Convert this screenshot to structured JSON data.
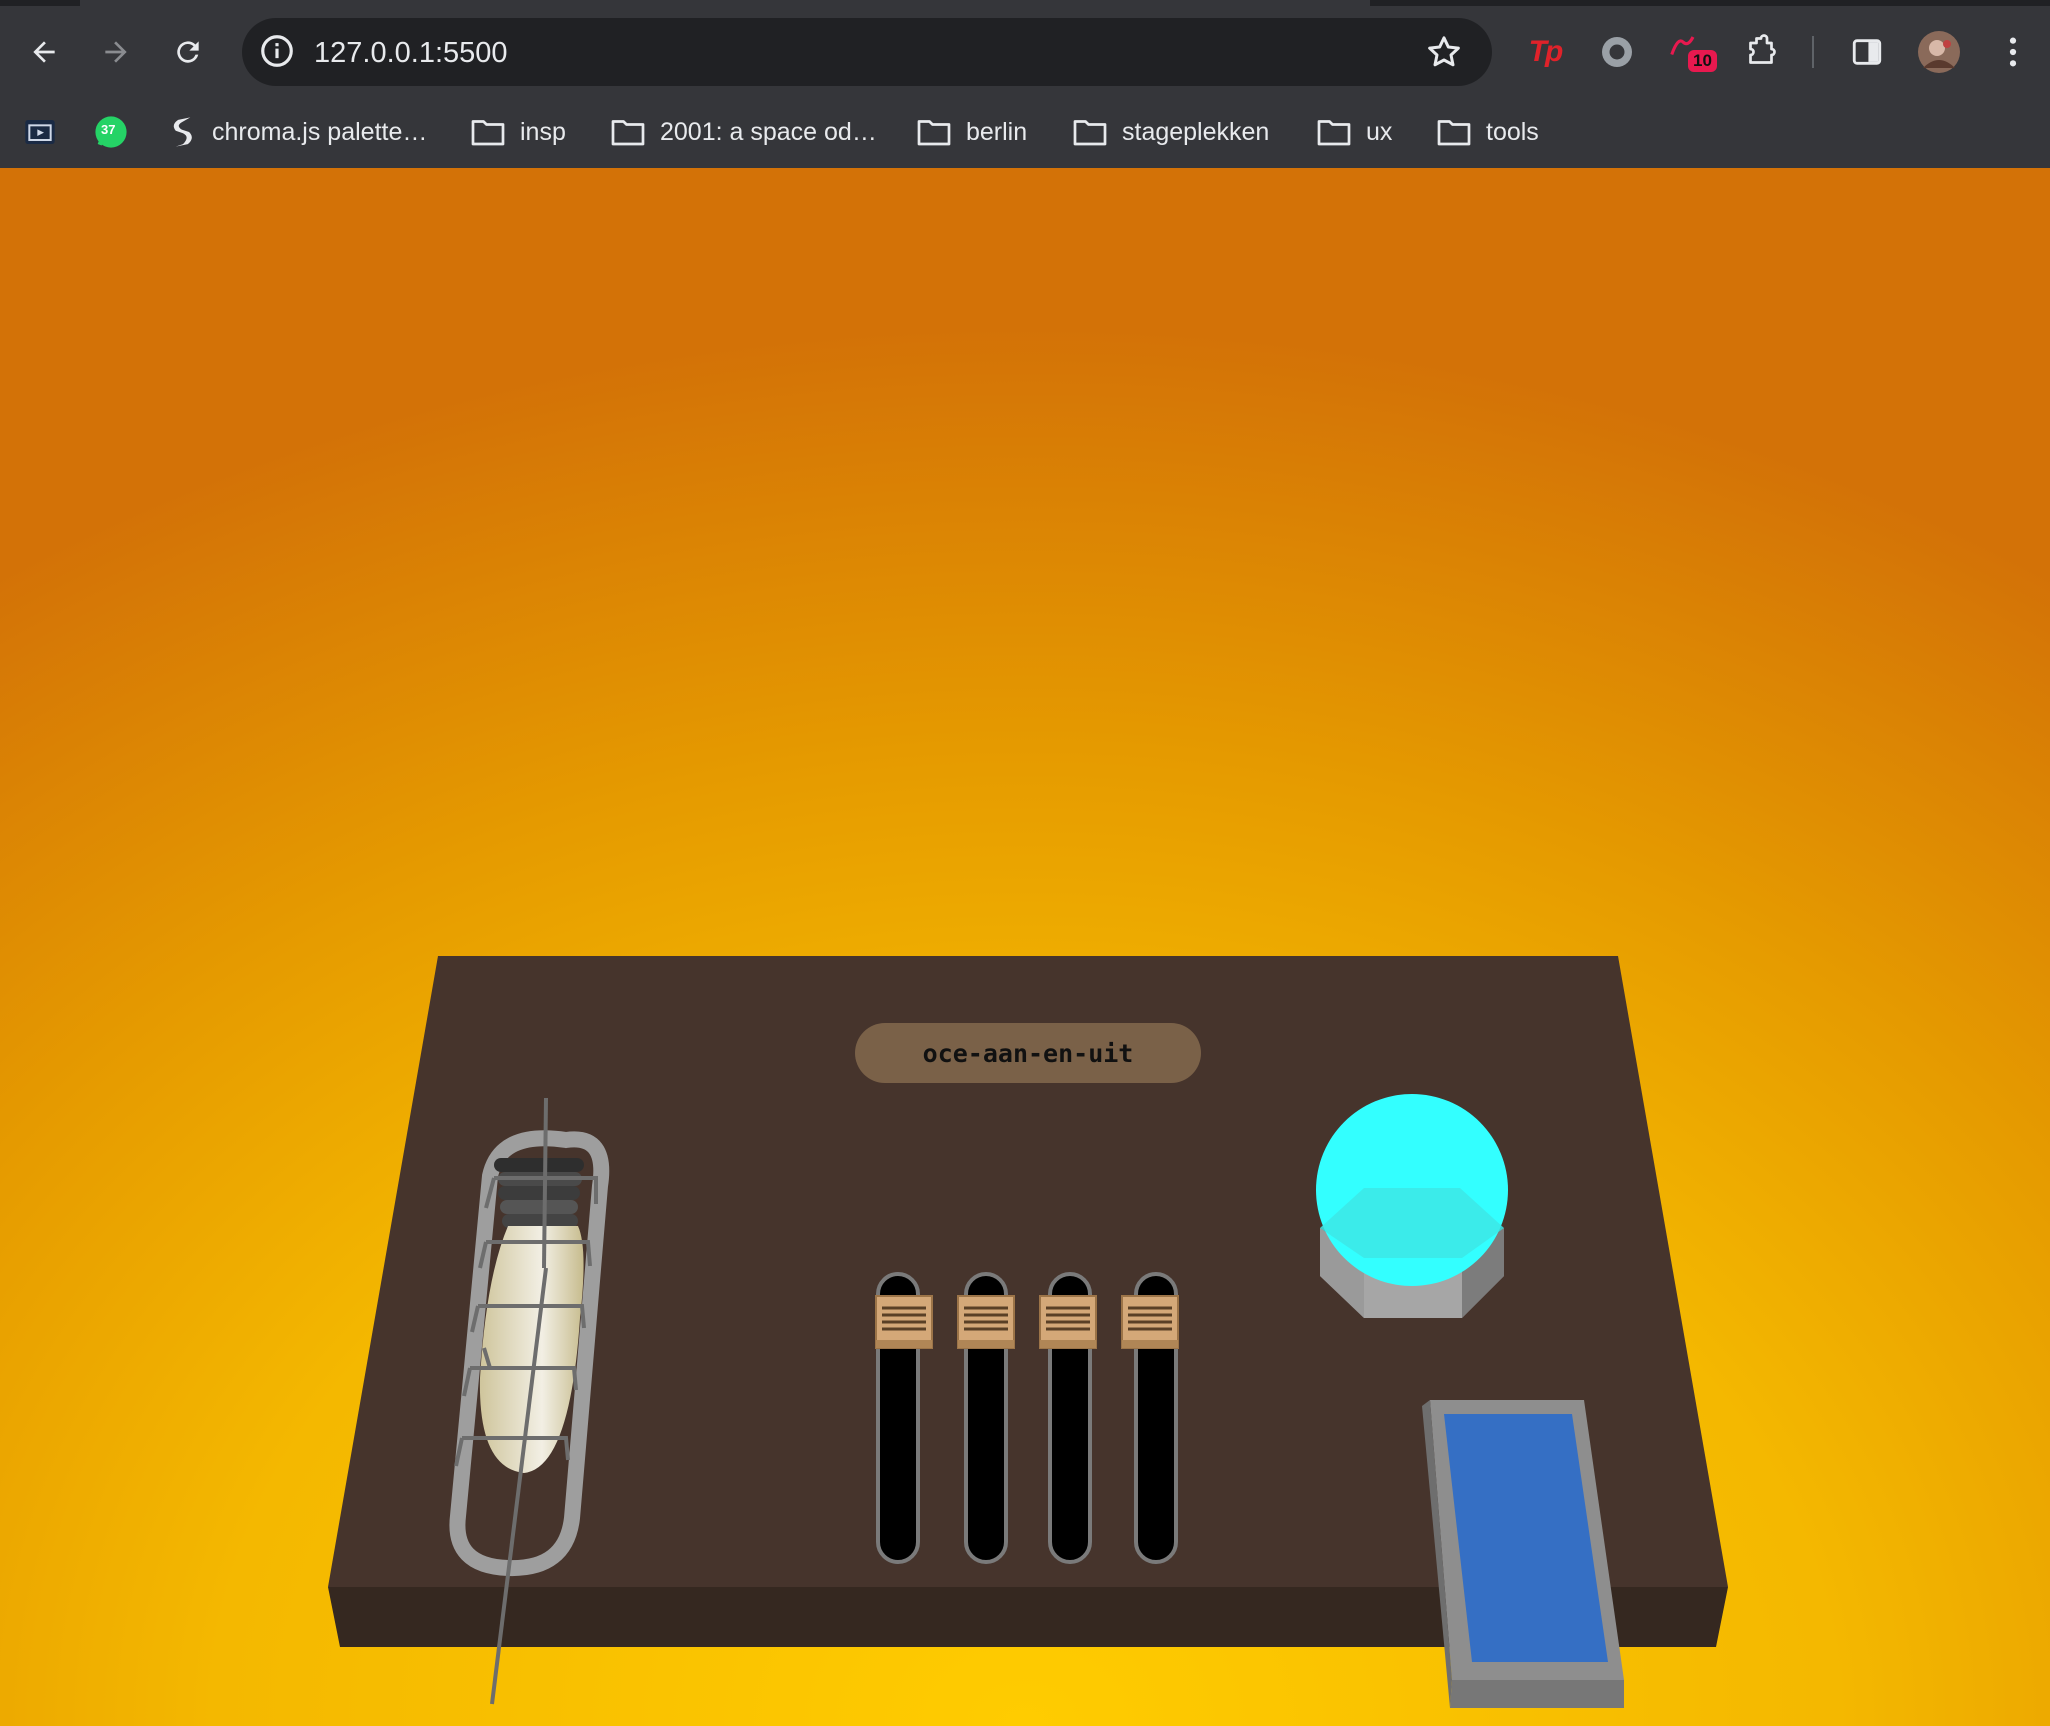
{
  "browser": {
    "url": "127.0.0.1:5500",
    "extensions": {
      "tp_label": "Tp",
      "badge_count": "10"
    },
    "bookmarks": [
      {
        "label": "",
        "icon": "tv-icon"
      },
      {
        "label": "",
        "icon": "whatsapp-icon",
        "badge": "37"
      },
      {
        "label": "chroma.js palette…",
        "icon": "chroma-icon"
      },
      {
        "label": "insp",
        "icon": "folder-icon"
      },
      {
        "label": "2001: a space od…",
        "icon": "folder-icon"
      },
      {
        "label": "berlin",
        "icon": "folder-icon"
      },
      {
        "label": "stageplekken",
        "icon": "folder-icon"
      },
      {
        "label": "ux",
        "icon": "folder-icon"
      },
      {
        "label": "tools",
        "icon": "folder-icon"
      }
    ]
  },
  "device": {
    "label": "oce-aan-en-uit",
    "slider_count": 4,
    "colors": {
      "board_top": "#46342c",
      "board_front": "#352820",
      "orb": "#33ffff",
      "screen": "#356fc4",
      "background_center": "#ffcc00",
      "background_edge": "#d37207"
    }
  }
}
